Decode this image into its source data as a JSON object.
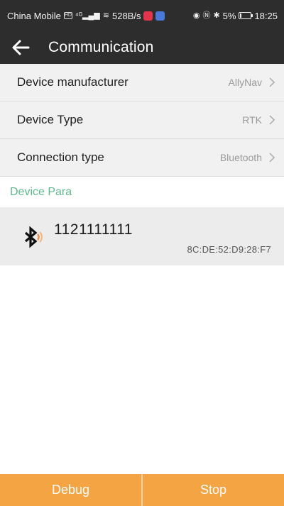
{
  "status_bar": {
    "carrier": "China Mobile",
    "net_speed": "528B/s",
    "battery": "5%",
    "time": "18:25"
  },
  "header": {
    "title": "Communication",
    "back_icon": "arrow-left-icon"
  },
  "settings": [
    {
      "label": "Device manufacturer",
      "value": "AllyNav"
    },
    {
      "label": "Device Type",
      "value": "RTK"
    },
    {
      "label": "Connection type",
      "value": "Bluetooth"
    }
  ],
  "section": {
    "title": "Device Para"
  },
  "devices": [
    {
      "name": "1121111111",
      "mac": "8C:DE:52:D9:28:F7",
      "icon": "bluetooth-icon"
    }
  ],
  "buttons": {
    "debug": "Debug",
    "stop": "Stop"
  },
  "colors": {
    "header_bg": "#2d2d2d",
    "accent_green": "#5cb98a",
    "button_orange": "#f5a443",
    "row_bg": "#f1f1f1"
  }
}
